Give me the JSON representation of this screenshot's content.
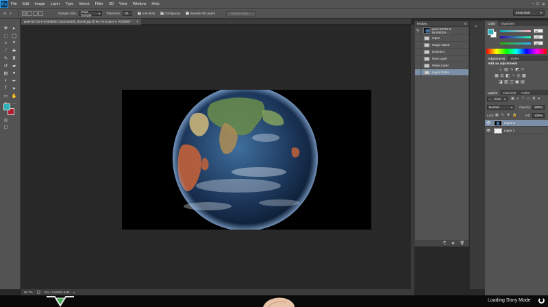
{
  "app": {
    "logo": "Ps",
    "window_controls": [
      "–",
      "□",
      "✕"
    ]
  },
  "menu": [
    "File",
    "Edit",
    "Image",
    "Layer",
    "Type",
    "Select",
    "Filter",
    "3D",
    "View",
    "Window",
    "Help"
  ],
  "options_bar": {
    "sample_size_label": "Sample Size:",
    "sample_size_value": "Point Sample",
    "tolerance_label": "Tolerance:",
    "tolerance_value": "20",
    "anti_alias_label": "Anti-alias",
    "contiguous_label": "Contiguous",
    "sample_all_label": "Sample All Layers",
    "refine_edge_label": "Refine Edge..."
  },
  "workspace": {
    "value": "Essentials"
  },
  "document": {
    "tab_title": "pixel-62710-0-94308000-1442445486_thumb.jpg @ 66.7% (Layer 0, RGB/8#) *",
    "close": "×"
  },
  "status": {
    "zoom": "66.7%",
    "doc_info": "Doc: 2.64M/2.64M"
  },
  "history": {
    "tab": "History",
    "snapshot_label": "pixel-62710-0-94308000-...",
    "items": [
      "Open",
      "Magic Wand",
      "Deselect",
      "New Layer",
      "Make Layer",
      "Layer Order"
    ],
    "selected_index": 5
  },
  "color_panel": {
    "tabs": [
      "Color",
      "Swatches"
    ],
    "r": "46",
    "g": "177",
    "b": "187",
    "fg_color": "#2eb1bb",
    "bg_color": "#ffffff"
  },
  "adjustments": {
    "tabs": [
      "Adjustments",
      "Styles"
    ],
    "title": "Add an adjustment"
  },
  "layers_panel": {
    "tabs": [
      "Layers",
      "Channels",
      "Paths"
    ],
    "filter_label": "Kind",
    "blend_mode": "Normal",
    "opacity_label": "Opacity:",
    "opacity_value": "100%",
    "lock_label": "Lock:",
    "fill_label": "Fill:",
    "fill_value": "100%",
    "layers": [
      {
        "name": "Layer 0",
        "selected": true
      },
      {
        "name": "Layer 1",
        "selected": false
      }
    ]
  },
  "overlay": {
    "loading_text": "Loading Story Mode"
  }
}
